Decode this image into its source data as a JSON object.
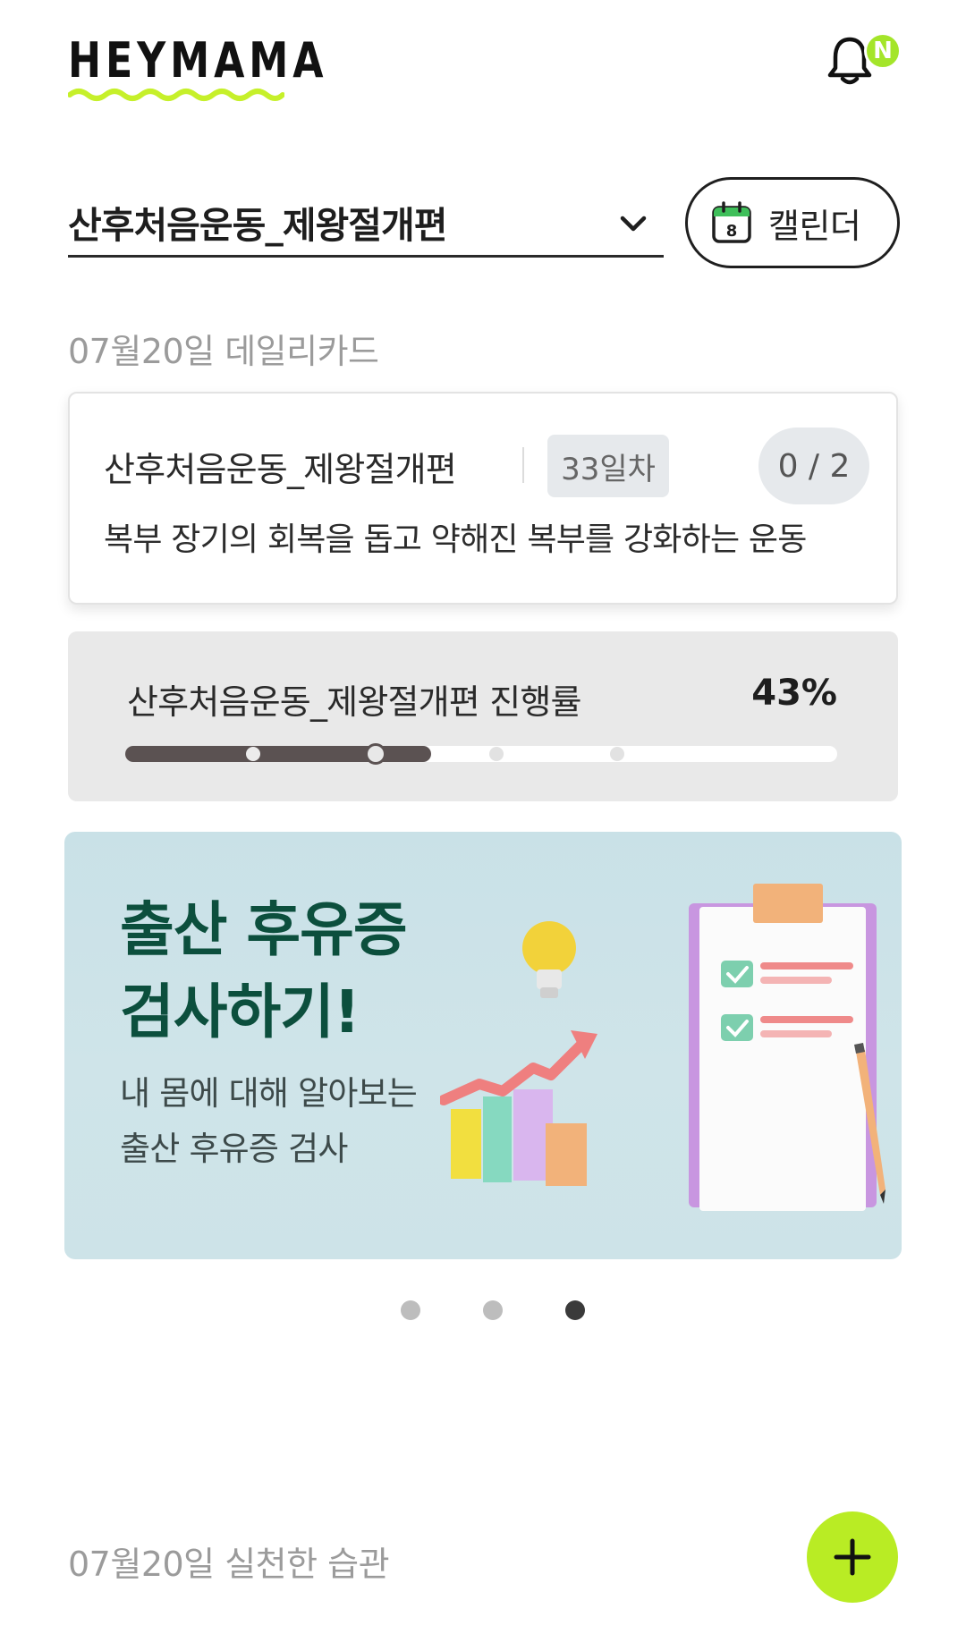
{
  "header": {
    "logo_text": "HEYMAMA",
    "notification_badge": "N",
    "logo_wave_color": "#c6f02a",
    "badge_color": "#a4e52a"
  },
  "program": {
    "selected": "산후처음운동_제왕절개편",
    "calendar_label": "캘린더",
    "calendar_icon_day": "8"
  },
  "daily": {
    "section_title": "07월20일 데일리카드",
    "card": {
      "name": "산후처음운동_제왕절개편",
      "day_badge": "33일차",
      "count": "0 / 2",
      "description": "복부 장기의 회복을 돕고 약해진 복부를 강화하는 운동"
    }
  },
  "progress": {
    "label": "산후처음운동_제왕절개편 진행률",
    "percent_label": "43%",
    "percent_value": 43,
    "fill_color": "#5b5252"
  },
  "banner": {
    "title_line1": "출산 후유증",
    "title_line2": "검사하기!",
    "sub_line1": "내 몸에 대해 알아보는",
    "sub_line2": "출산 후유증 검사",
    "title_color": "#0c4f3d",
    "bg_color": "#cbe2e8"
  },
  "carousel": {
    "count": 3,
    "active_index": 2
  },
  "habits": {
    "section_title": "07월20일 실천한 습관",
    "add_icon": "plus-icon",
    "fab_color": "#b9ec24"
  }
}
